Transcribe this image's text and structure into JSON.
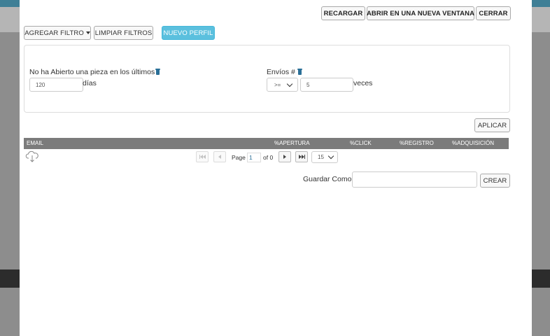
{
  "backdrop": {
    "topbar_color": "#3f7f96",
    "dark_band_color": "#2c2c2c"
  },
  "toolbar": {
    "reload_label": "RECARGAR",
    "open_new_window_label": "ABRIR EN UNA NUEVA VENTANA",
    "close_label": "CERRAR"
  },
  "filters_bar": {
    "add_filter_label": "AGREGAR FILTRO",
    "clear_filters_label": "LIMPIAR FILTROS",
    "new_profile_label": "NUEVO PERFIL",
    "accent_color": "#5bc0de"
  },
  "filters": {
    "not_opened": {
      "label": "No ha Abierto una pieza en los últimos",
      "value": "120",
      "suffix": "días"
    },
    "sends": {
      "label": "Envíos #",
      "operator": ">=",
      "value": "5",
      "suffix": "veces"
    }
  },
  "apply_label": "APLICAR",
  "grid": {
    "columns": [
      "EMAIL",
      "%APERTURA",
      "%CLICK",
      "%REGISTRO",
      "%ADQUISICIÓN"
    ],
    "header_color": "#7b7b7b"
  },
  "pager": {
    "page_label": "Page",
    "current_page": "1",
    "of_label": "of 0",
    "page_size": "15"
  },
  "save": {
    "label": "Guardar Como",
    "value": "",
    "create_label": "CREAR"
  },
  "icons": [
    "cloud-download-icon",
    "trash-icon",
    "chevron-down-icon",
    "caret-down-icon",
    "first-page-icon",
    "prev-page-icon",
    "next-page-icon",
    "last-page-icon"
  ]
}
